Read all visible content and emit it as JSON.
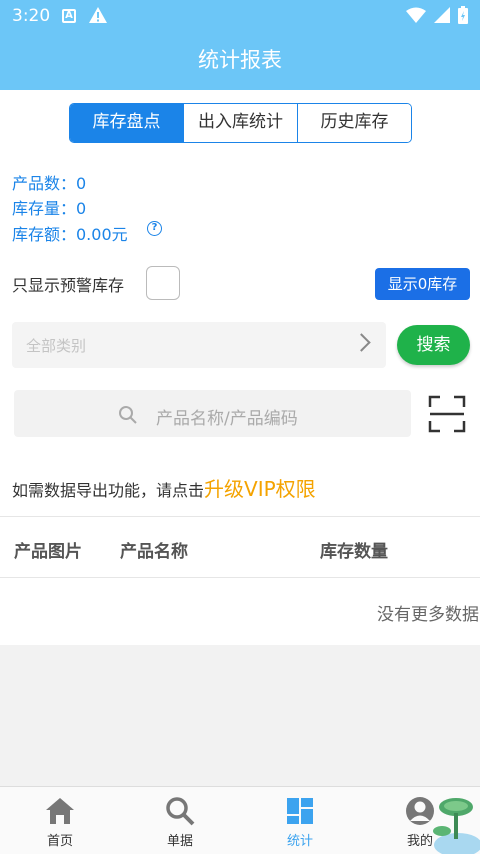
{
  "status_bar": {
    "time": "3:20",
    "notif_letter": "A"
  },
  "header": {
    "title": "统计报表"
  },
  "tabs": [
    {
      "label": "库存盘点",
      "active": true
    },
    {
      "label": "出入库统计",
      "active": false
    },
    {
      "label": "历史库存",
      "active": false
    }
  ],
  "stats": {
    "product_count": "产品数：0",
    "stock_qty": "库存量：0",
    "stock_amount": "库存额：0.00元"
  },
  "filter": {
    "warning_label": "只显示预警库存",
    "show_zero_button": "显示0库存",
    "category_placeholder": "全部类别",
    "search_button": "搜索",
    "search_placeholder": "产品名称/产品编码"
  },
  "vip": {
    "prefix": "如需数据导出功能，请点击",
    "link": "升级VIP权限"
  },
  "table": {
    "headers": [
      "产品图片",
      "产品名称",
      "库存数量"
    ],
    "empty_text": "没有更多数据"
  },
  "bottom_nav": [
    {
      "label": "首页",
      "icon": "home-icon",
      "active": false
    },
    {
      "label": "单据",
      "icon": "search-icon",
      "active": false
    },
    {
      "label": "统计",
      "icon": "stats-icon",
      "active": true
    },
    {
      "label": "我的",
      "icon": "user-icon",
      "active": false
    }
  ],
  "colors": {
    "primary": "#1b84e8",
    "header": "#6cc6f7",
    "search_green": "#1fb24a",
    "vip_orange": "#f4a300"
  }
}
